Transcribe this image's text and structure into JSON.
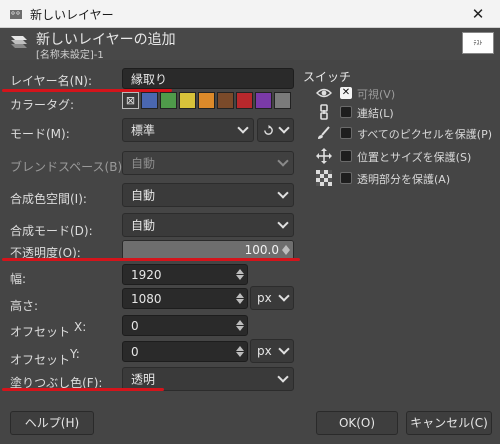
{
  "window": {
    "title": "新しいレイヤー",
    "close_glyph": "✕"
  },
  "header": {
    "title": "新しいレイヤーの追加",
    "subtitle": "[名称未設定]-1",
    "thumb_label": "ﾃｽﾄ"
  },
  "form": {
    "layer_name": {
      "label": "レイヤー名(N):",
      "value": "縁取り"
    },
    "color_tag": {
      "label": "カラータグ:",
      "tags": [
        {
          "name": "none",
          "color": "#3a3a3a"
        },
        {
          "name": "blue",
          "color": "#4a67b0"
        },
        {
          "name": "green",
          "color": "#4f9a4a"
        },
        {
          "name": "yellow",
          "color": "#d8c23a"
        },
        {
          "name": "orange",
          "color": "#dc8a2a"
        },
        {
          "name": "brown",
          "color": "#7a4a2a"
        },
        {
          "name": "red",
          "color": "#b8282c"
        },
        {
          "name": "violet",
          "color": "#7a3aa8"
        },
        {
          "name": "gray",
          "color": "#7b7b7b"
        }
      ]
    },
    "mode": {
      "label": "モード(M):",
      "value": "標準"
    },
    "blend_space": {
      "label": "ブレンドスペース(B):",
      "value": "自動"
    },
    "composite_space": {
      "label": "合成色空間(I):",
      "value": "自動"
    },
    "composite_mode": {
      "label": "合成モード(D):",
      "value": "自動"
    },
    "opacity": {
      "label": "不透明度(O):",
      "value": "100.0",
      "fraction": 1.0
    },
    "width": {
      "label": "幅:",
      "value": "1920"
    },
    "height": {
      "label": "高さ:",
      "value": "1080",
      "unit": "px"
    },
    "offset_x": {
      "label": "オフセット",
      "axis": "X:",
      "value": "0"
    },
    "offset_y": {
      "label": "オフセット",
      "axis": "Y:",
      "value": "0",
      "unit": "px"
    },
    "fill": {
      "label": "塗りつぶし色(F):",
      "value": "透明"
    }
  },
  "switches": {
    "title": "スイッチ",
    "items": [
      {
        "icon": "eye-icon",
        "label": "可視(V)",
        "checked": true
      },
      {
        "icon": "chain-icon",
        "label": "連結(L)",
        "checked": false
      },
      {
        "icon": "brush-icon",
        "label": "すべてのピクセルを保護(P)",
        "checked": false
      },
      {
        "icon": "move-icon",
        "label": "位置とサイズを保護(S)",
        "checked": false
      },
      {
        "icon": "checkerboard-icon",
        "label": "透明部分を保護(A)",
        "checked": false
      }
    ]
  },
  "buttons": {
    "help": "ヘルプ(H)",
    "ok": "OK(O)",
    "cancel": "キャンセル(C)"
  },
  "accent_colors": {
    "annotation_underline": "#d4141b"
  }
}
